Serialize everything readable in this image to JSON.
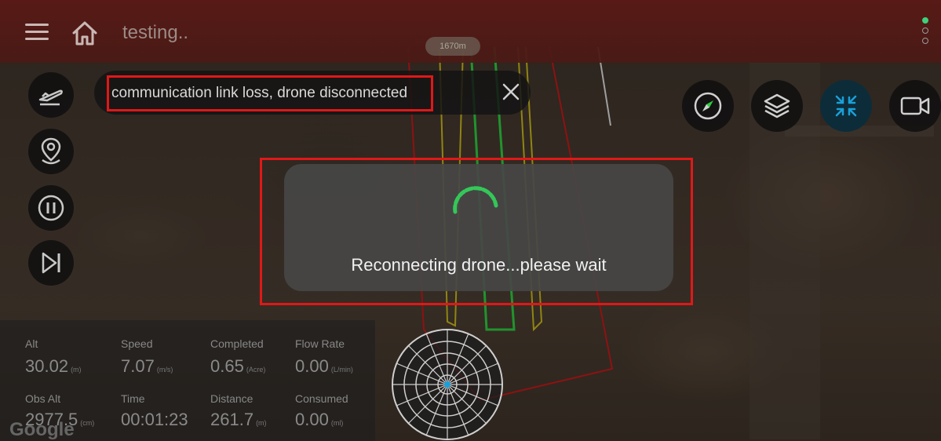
{
  "header": {
    "title": "testing..",
    "scale_label": "1670m"
  },
  "alert": {
    "message": "communication link loss, drone disconnected"
  },
  "modal": {
    "message": "Reconnecting drone...please wait",
    "spinner_color": "#34c759"
  },
  "colors": {
    "topbar": "#4a1a16",
    "highlight": "#e01818",
    "accent": "#1aa0d8",
    "path_red": "#c41a1a",
    "path_yellow": "#c9b81a",
    "path_green": "#2ecc40"
  },
  "telemetry": {
    "alt": {
      "label": "Alt",
      "value": "30.02",
      "unit": "(m)"
    },
    "speed": {
      "label": "Speed",
      "value": "7.07",
      "unit": "(m/s)"
    },
    "completed": {
      "label": "Completed",
      "value": "0.65",
      "unit": "(Acre)"
    },
    "flow_rate": {
      "label": "Flow Rate",
      "value": "0.00",
      "unit": "(L/min)"
    },
    "obs_alt": {
      "label": "Obs Alt",
      "value": "2977.5",
      "unit": "(cm)"
    },
    "time": {
      "label": "Time",
      "value": "00:01:23",
      "unit": ""
    },
    "distance": {
      "label": "Distance",
      "value": "261.7",
      "unit": "(m)"
    },
    "consumed": {
      "label": "Consumed",
      "value": "0.00",
      "unit": "(ml)"
    }
  },
  "map": {
    "attribution": "Google"
  },
  "icons": {
    "menu": "menu-icon",
    "home": "home-icon",
    "more": "more-vertical-icon",
    "takeoff": "takeoff-icon",
    "location": "location-pin-icon",
    "pause": "pause-icon",
    "skip": "skip-next-icon",
    "close": "close-icon",
    "compass": "compass-icon",
    "layers": "layers-icon",
    "collapse": "collapse-icon",
    "camera": "video-camera-icon"
  }
}
